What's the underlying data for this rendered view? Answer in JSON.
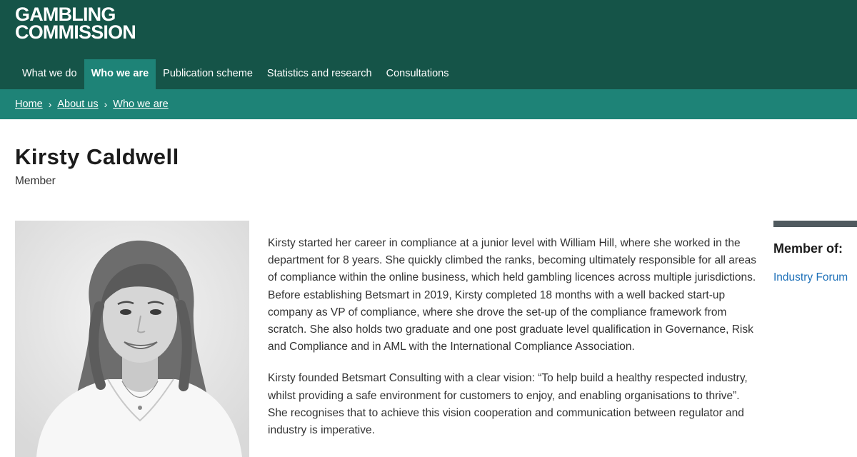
{
  "header": {
    "logo_line1": "GAMBLING",
    "logo_line2": "COMMISSION",
    "nav": [
      {
        "label": "What we do"
      },
      {
        "label": "Who we are",
        "active": true
      },
      {
        "label": "Publication scheme"
      },
      {
        "label": "Statistics and research"
      },
      {
        "label": "Consultations"
      }
    ]
  },
  "breadcrumb": [
    "Home",
    "About us",
    "Who we are"
  ],
  "profile": {
    "name": "Kirsty Caldwell",
    "role": "Member",
    "bio": [
      "Kirsty started her career in compliance at a junior level with William Hill, where she worked in the department for 8 years. She quickly climbed the ranks, becoming ultimately responsible for all areas of compliance within the online business, which held gambling licences across multiple jurisdictions. Before establishing Betsmart in 2019, Kirsty completed 18 months with a well backed start-up company as VP of compliance, where she drove the set-up of the compliance framework from scratch. She also holds two graduate and one post graduate level qualification in Governance, Risk and Compliance and in AML with the International Compliance Association.",
      "Kirsty founded Betsmart Consulting with a clear vision: “To help build a healthy respected industry, whilst providing a safe environment for customers to enjoy, and enabling organisations to thrive”. She recognises that to achieve this vision cooperation and communication between regulator and industry is imperative."
    ]
  },
  "sidebar": {
    "heading": "Member of:",
    "link": "Industry Forum"
  },
  "colors": {
    "header_bg": "#155448",
    "nav_active_bg": "#1e8377",
    "breadcrumb_bg": "#1e8377",
    "link": "#1d70b8"
  }
}
